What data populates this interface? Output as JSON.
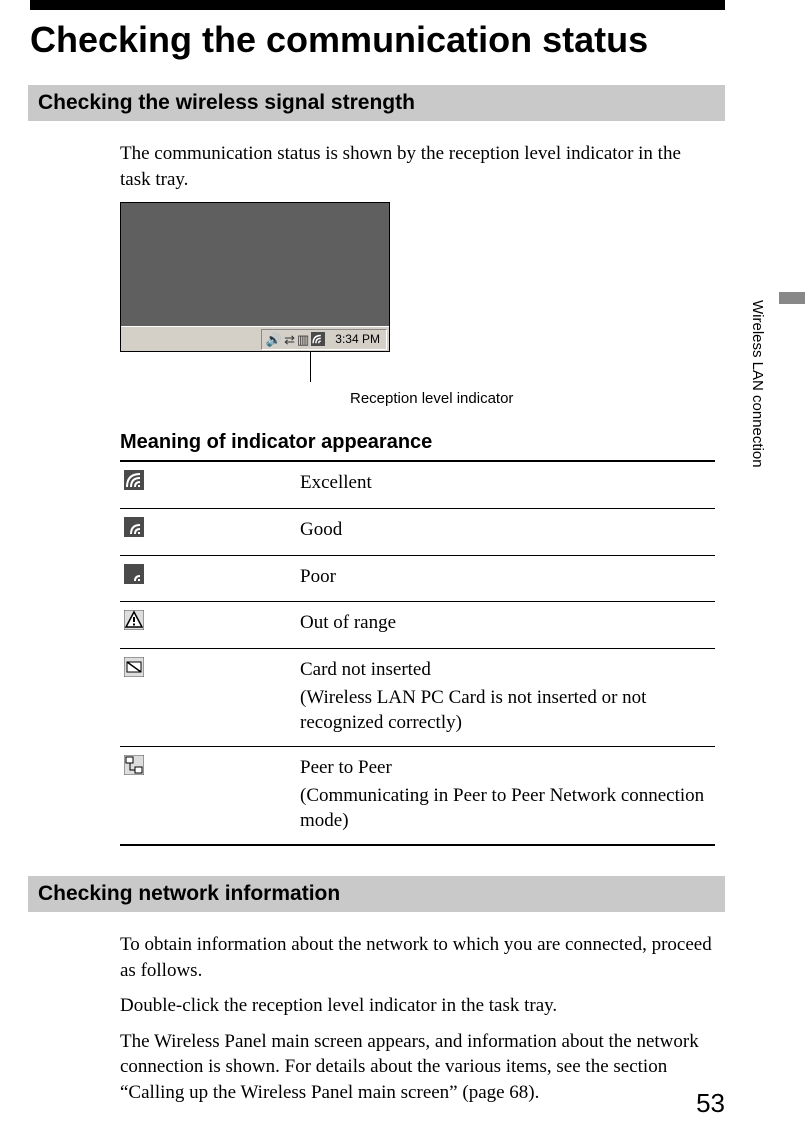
{
  "page_title": "Checking the communication status",
  "section1_heading": "Checking the wireless signal strength",
  "intro_text": "The communication status is shown by the reception level indicator in the task tray.",
  "tasktray_clock": "3:34 PM",
  "callout_label": "Reception level indicator",
  "subheading": "Meaning of indicator appearance",
  "indicators": [
    {
      "label": "Excellent",
      "sub": ""
    },
    {
      "label": "Good",
      "sub": ""
    },
    {
      "label": "Poor",
      "sub": ""
    },
    {
      "label": "Out of range",
      "sub": ""
    },
    {
      "label": "Card not inserted",
      "sub": "(Wireless LAN PC Card is not inserted or not recognized correctly)"
    },
    {
      "label": "Peer to Peer",
      "sub": "(Communicating in Peer to Peer Network connection mode)"
    }
  ],
  "section2_heading": "Checking network information",
  "section2_body": [
    "To obtain information about the network to which you are connected, proceed as follows.",
    "Double-click the reception level indicator in the task tray.",
    "The Wireless Panel main screen appears, and information about the network connection is shown. For details about the various items, see the section “Calling up the Wireless Panel main screen” (page 68)."
  ],
  "side_tab_label": "Wireless LAN connection",
  "page_number": "53"
}
